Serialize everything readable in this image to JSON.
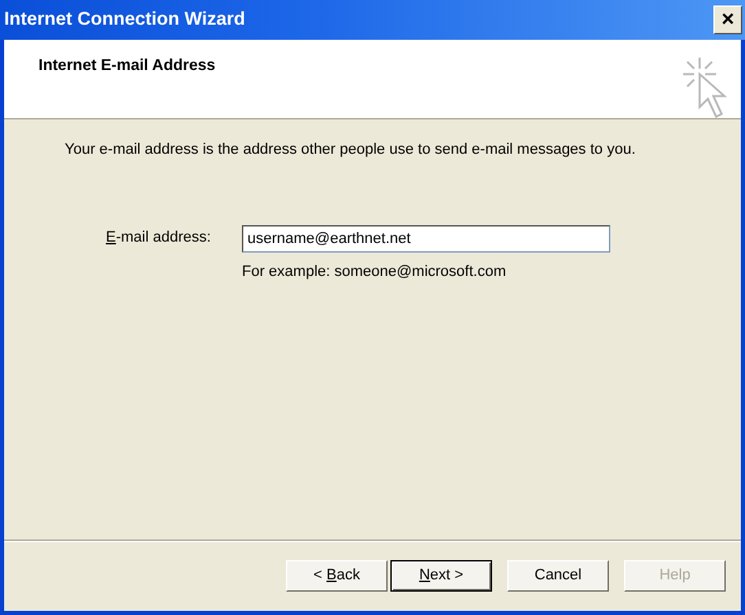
{
  "window": {
    "title": "Internet Connection Wizard",
    "close_label": "×"
  },
  "header": {
    "title": "Internet E-mail Address"
  },
  "intro": "Your e-mail address is the address other people use to send e-mail messages to you.",
  "email": {
    "label": {
      "key": "E",
      "rest": "-mail address:"
    },
    "value": "username@earthnet.net",
    "hint": "For example: someone@microsoft.com"
  },
  "buttons": [
    {
      "before": "< ",
      "key": "B",
      "rest": "ack",
      "default": false,
      "disabled": false
    },
    {
      "key": "N",
      "rest": "ext >",
      "default": true,
      "disabled": false
    },
    {
      "rest": "Cancel",
      "default": false,
      "disabled": false
    },
    {
      "rest": "Help",
      "default": false,
      "disabled": true
    }
  ]
}
